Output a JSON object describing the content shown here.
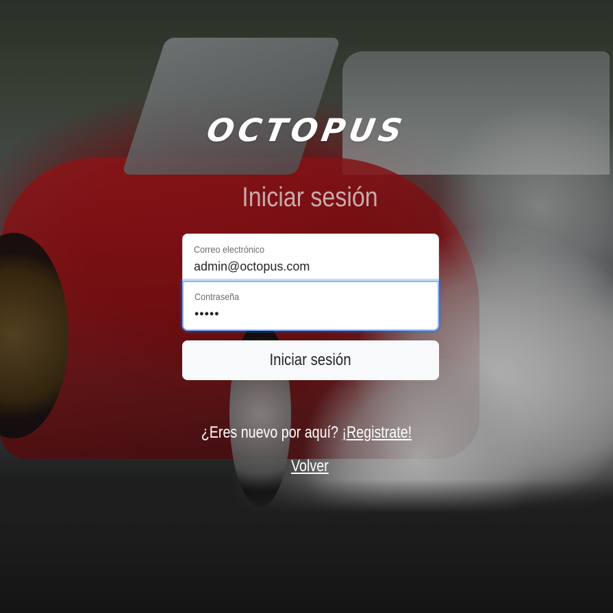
{
  "brand": {
    "logo_text": "OCTOPUS"
  },
  "login": {
    "title": "Iniciar sesión",
    "email": {
      "label": "Correo electrónico",
      "value": "admin@octopus.com",
      "placeholder": "Correo electrónico"
    },
    "password": {
      "label": "Contraseña",
      "value": "•••••",
      "placeholder": "Contraseña"
    },
    "submit_label": "Iniciar sesión"
  },
  "footer": {
    "register_prompt": "¿Eres nuevo por aquí? ",
    "register_link": "¡Registrate!",
    "back_link": "Volver"
  },
  "colors": {
    "button_bg": "#f8f9fa",
    "focus_border": "#86b7fe",
    "text_light": "#ffffff"
  }
}
